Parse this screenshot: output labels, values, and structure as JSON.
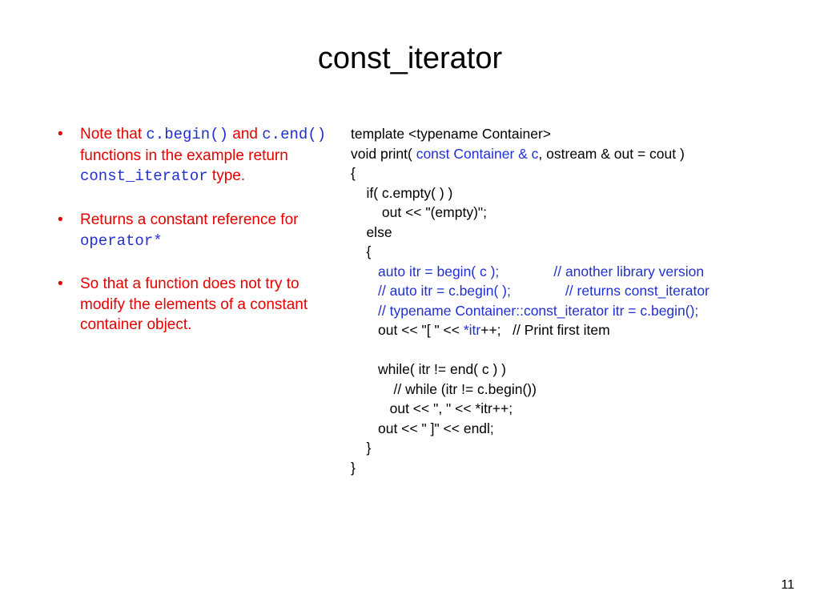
{
  "title": "const_iterator",
  "bullets": {
    "b1": {
      "t1": "Note that ",
      "c1": "c.begin()",
      "t2": " and ",
      "c2": "c.end()",
      "t3": " functions in the example return ",
      "c3": "const_iterator",
      "t4": " type."
    },
    "b2": {
      "t1": "Returns a constant reference for ",
      "c1": "operator*"
    },
    "b3": {
      "t1": "So that a function does not try to modify the elements of a constant container object."
    }
  },
  "code": {
    "l1": "template <typename Container>",
    "l2a": "void print( ",
    "l2b": "const Container & c",
    "l2c": ", ostream & out = cout )",
    "l3": "{",
    "l4": "    if( c.empty( ) )",
    "l5": "        out << \"(empty)\";",
    "l6": "    else",
    "l7": "    {",
    "l8a": "       auto itr = begin( c );",
    "l8b": "              // another library version",
    "l9": "       // auto itr = c.begin( );              // returns const_iterator",
    "l10": "       // typename Container::const_iterator itr = c.begin();",
    "l11a": "       out << \"[ \" << ",
    "l11b": "*itr",
    "l11c": "++;   // Print first item",
    "l12": "",
    "l13": "       while( itr != end( c ) )",
    "l14": "           // while (itr != c.begin())",
    "l15": "          out << \", \" << *itr++;",
    "l16": "       out << \" ]\" << endl;",
    "l17": "    }",
    "l18": "}"
  },
  "pagenum": "11"
}
